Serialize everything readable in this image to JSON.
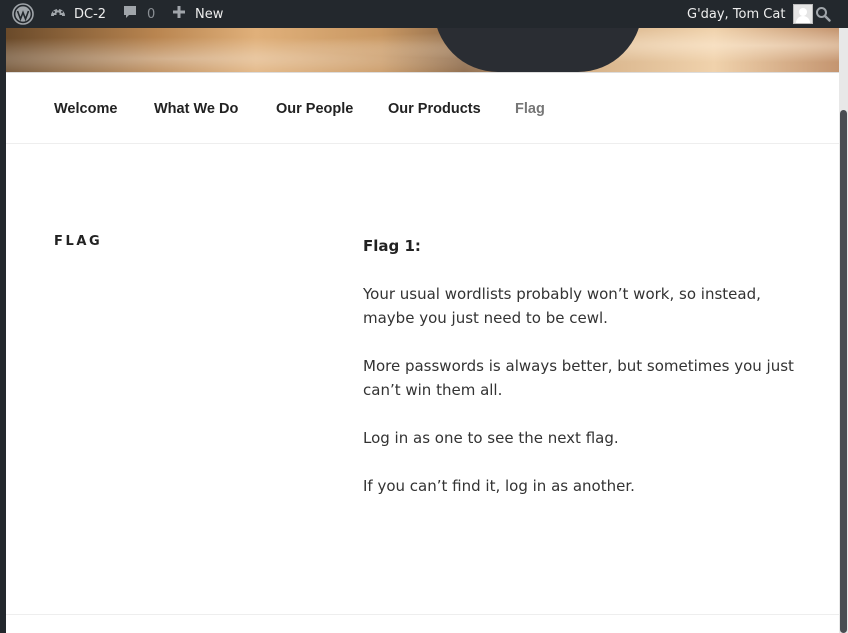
{
  "adminbar": {
    "wordpress_icon": "wordpress-logo-icon",
    "site_icon": "dashboard-icon",
    "site_name": "DC-2",
    "comments_icon": "comment-bubble-icon",
    "comments_count": "0",
    "new_icon": "plus-icon",
    "new_label": "New",
    "greeting": "G'day, Tom Cat",
    "avatar_icon": "user-avatar-icon",
    "search_icon": "search-icon"
  },
  "nav": {
    "items": [
      {
        "label": "Welcome"
      },
      {
        "label": "What We Do"
      },
      {
        "label": "Our People"
      },
      {
        "label": "Our Products"
      },
      {
        "label": "Flag"
      }
    ],
    "current": "Flag"
  },
  "page": {
    "title": "FLAG",
    "heading": "Flag 1:",
    "paragraphs": [
      "Your usual wordlists probably won’t work, so instead, maybe you just need to be cewl.",
      "More passwords is always better, but sometimes you just can’t win them all.",
      "Log in as one to see the next flag.",
      "If you can’t find it, log in as another."
    ]
  },
  "colors": {
    "adminbar_bg": "#23282d",
    "nav_text": "#222222",
    "nav_current": "#767676"
  }
}
